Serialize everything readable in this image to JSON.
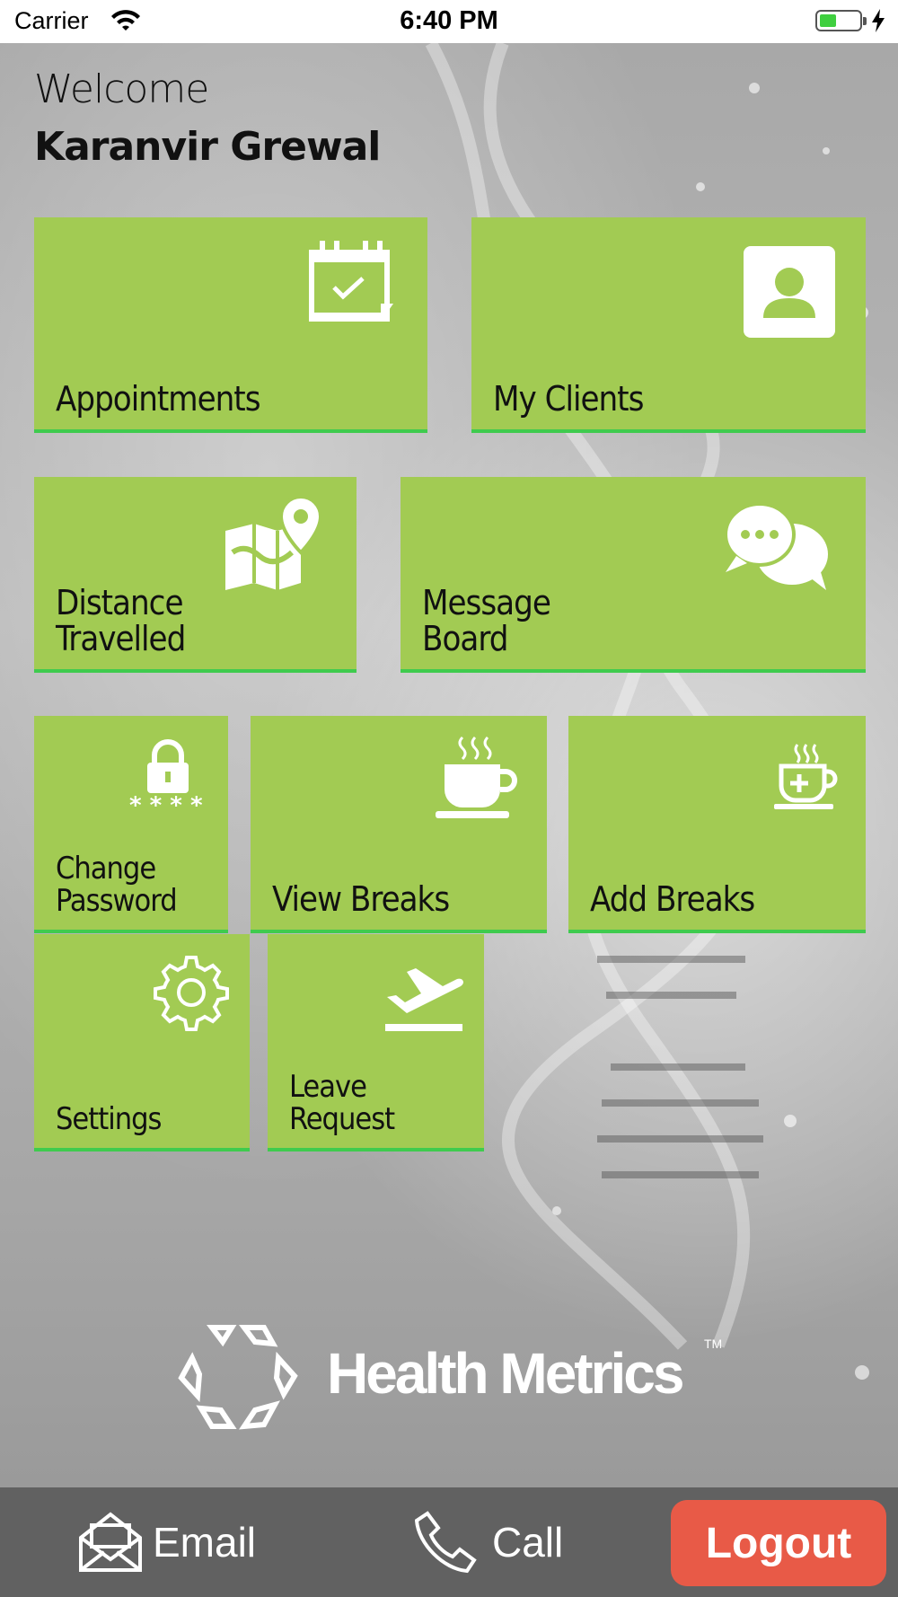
{
  "status_bar": {
    "carrier": "Carrier",
    "time": "6:40 PM"
  },
  "header": {
    "welcome": "Welcome",
    "user_name": "Karanvir Grewal"
  },
  "tiles": {
    "appointments": {
      "label": "Appointments",
      "icon": "calendar-check-icon"
    },
    "my_clients": {
      "label": "My Clients",
      "icon": "contact-card-icon"
    },
    "distance_travelled": {
      "label": "Distance\nTravelled",
      "icon": "map-pin-icon"
    },
    "message_board": {
      "label": "Message\nBoard",
      "icon": "chat-bubbles-icon"
    },
    "change_password": {
      "label": "Change\nPassword",
      "icon": "lock-password-icon"
    },
    "view_breaks": {
      "label": "View Breaks",
      "icon": "coffee-cup-icon"
    },
    "add_breaks": {
      "label": "Add Breaks",
      "icon": "coffee-cup-plus-icon"
    },
    "settings": {
      "label": "Settings",
      "icon": "gear-icon"
    },
    "leave_request": {
      "label": "Leave\nRequest",
      "icon": "airplane-departure-icon"
    }
  },
  "brand": {
    "name": "Health Metrics",
    "tm": "TM"
  },
  "bottom_bar": {
    "email": "Email",
    "call": "Call",
    "logout": "Logout"
  },
  "colors": {
    "tile": "#a2cb53",
    "tile_border": "#3fcb4e",
    "bottom_bar": "#616161",
    "logout": "#e85a47"
  }
}
